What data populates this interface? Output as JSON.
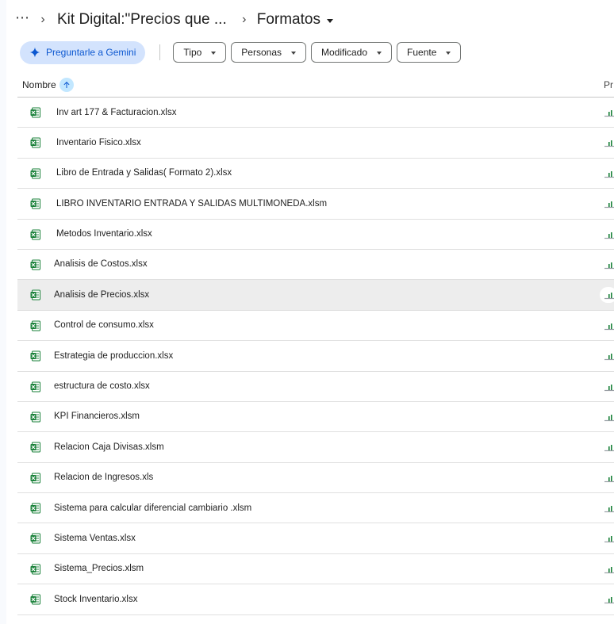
{
  "breadcrumb": {
    "more_label": "⋯",
    "parent": "Kit Digital:\"Precios que ...",
    "current": "Formatos"
  },
  "toolbar": {
    "gemini_label": "Preguntarle a Gemini",
    "filters": [
      "Tipo",
      "Personas",
      "Modificado",
      "Fuente"
    ]
  },
  "list": {
    "name_header": "Nombre",
    "owner_header_truncated": "Pr",
    "files": [
      {
        "name": "Inv art 177 & Facturacion.xlsx",
        "indent": true
      },
      {
        "name": "Inventario Fisico.xlsx",
        "indent": true
      },
      {
        "name": "Libro de Entrada y Salidas( Formato 2).xlsx",
        "indent": true
      },
      {
        "name": "LIBRO INVENTARIO ENTRADA Y SALIDAS MULTIMONEDA.xlsm",
        "indent": true
      },
      {
        "name": "Metodos Inventario.xlsx",
        "indent": true
      },
      {
        "name": "Analisis de Costos.xlsx",
        "indent": false
      },
      {
        "name": "Analisis de Precios.xlsx",
        "indent": false,
        "selected": true
      },
      {
        "name": "Control de consumo.xlsx",
        "indent": false
      },
      {
        "name": "Estrategia de produccion.xlsx",
        "indent": false
      },
      {
        "name": "estructura de costo.xlsx",
        "indent": false
      },
      {
        "name": "KPI Financieros.xlsm",
        "indent": false
      },
      {
        "name": "Relacion Caja Divisas.xlsm",
        "indent": false
      },
      {
        "name": "Relacion de Ingresos.xls",
        "indent": false
      },
      {
        "name": "Sistema para calcular diferencial cambiario .xlsm",
        "indent": false
      },
      {
        "name": "Sistema Ventas.xlsx",
        "indent": false
      },
      {
        "name": "Sistema_Precios.xlsm",
        "indent": false
      },
      {
        "name": "Stock Inventario.xlsx",
        "indent": false
      }
    ]
  },
  "icons": {
    "file": "excel-icon",
    "owner": "shared-drive-icon",
    "sort": "arrow-up-icon",
    "gemini": "gemini-sparkle-icon"
  },
  "colors": {
    "excel_green": "#188038",
    "gemini_bg": "#d3e3fd",
    "gemini_text": "#0b57d0",
    "sort_bg": "#c2e7ff",
    "selected_row": "#ededed"
  }
}
